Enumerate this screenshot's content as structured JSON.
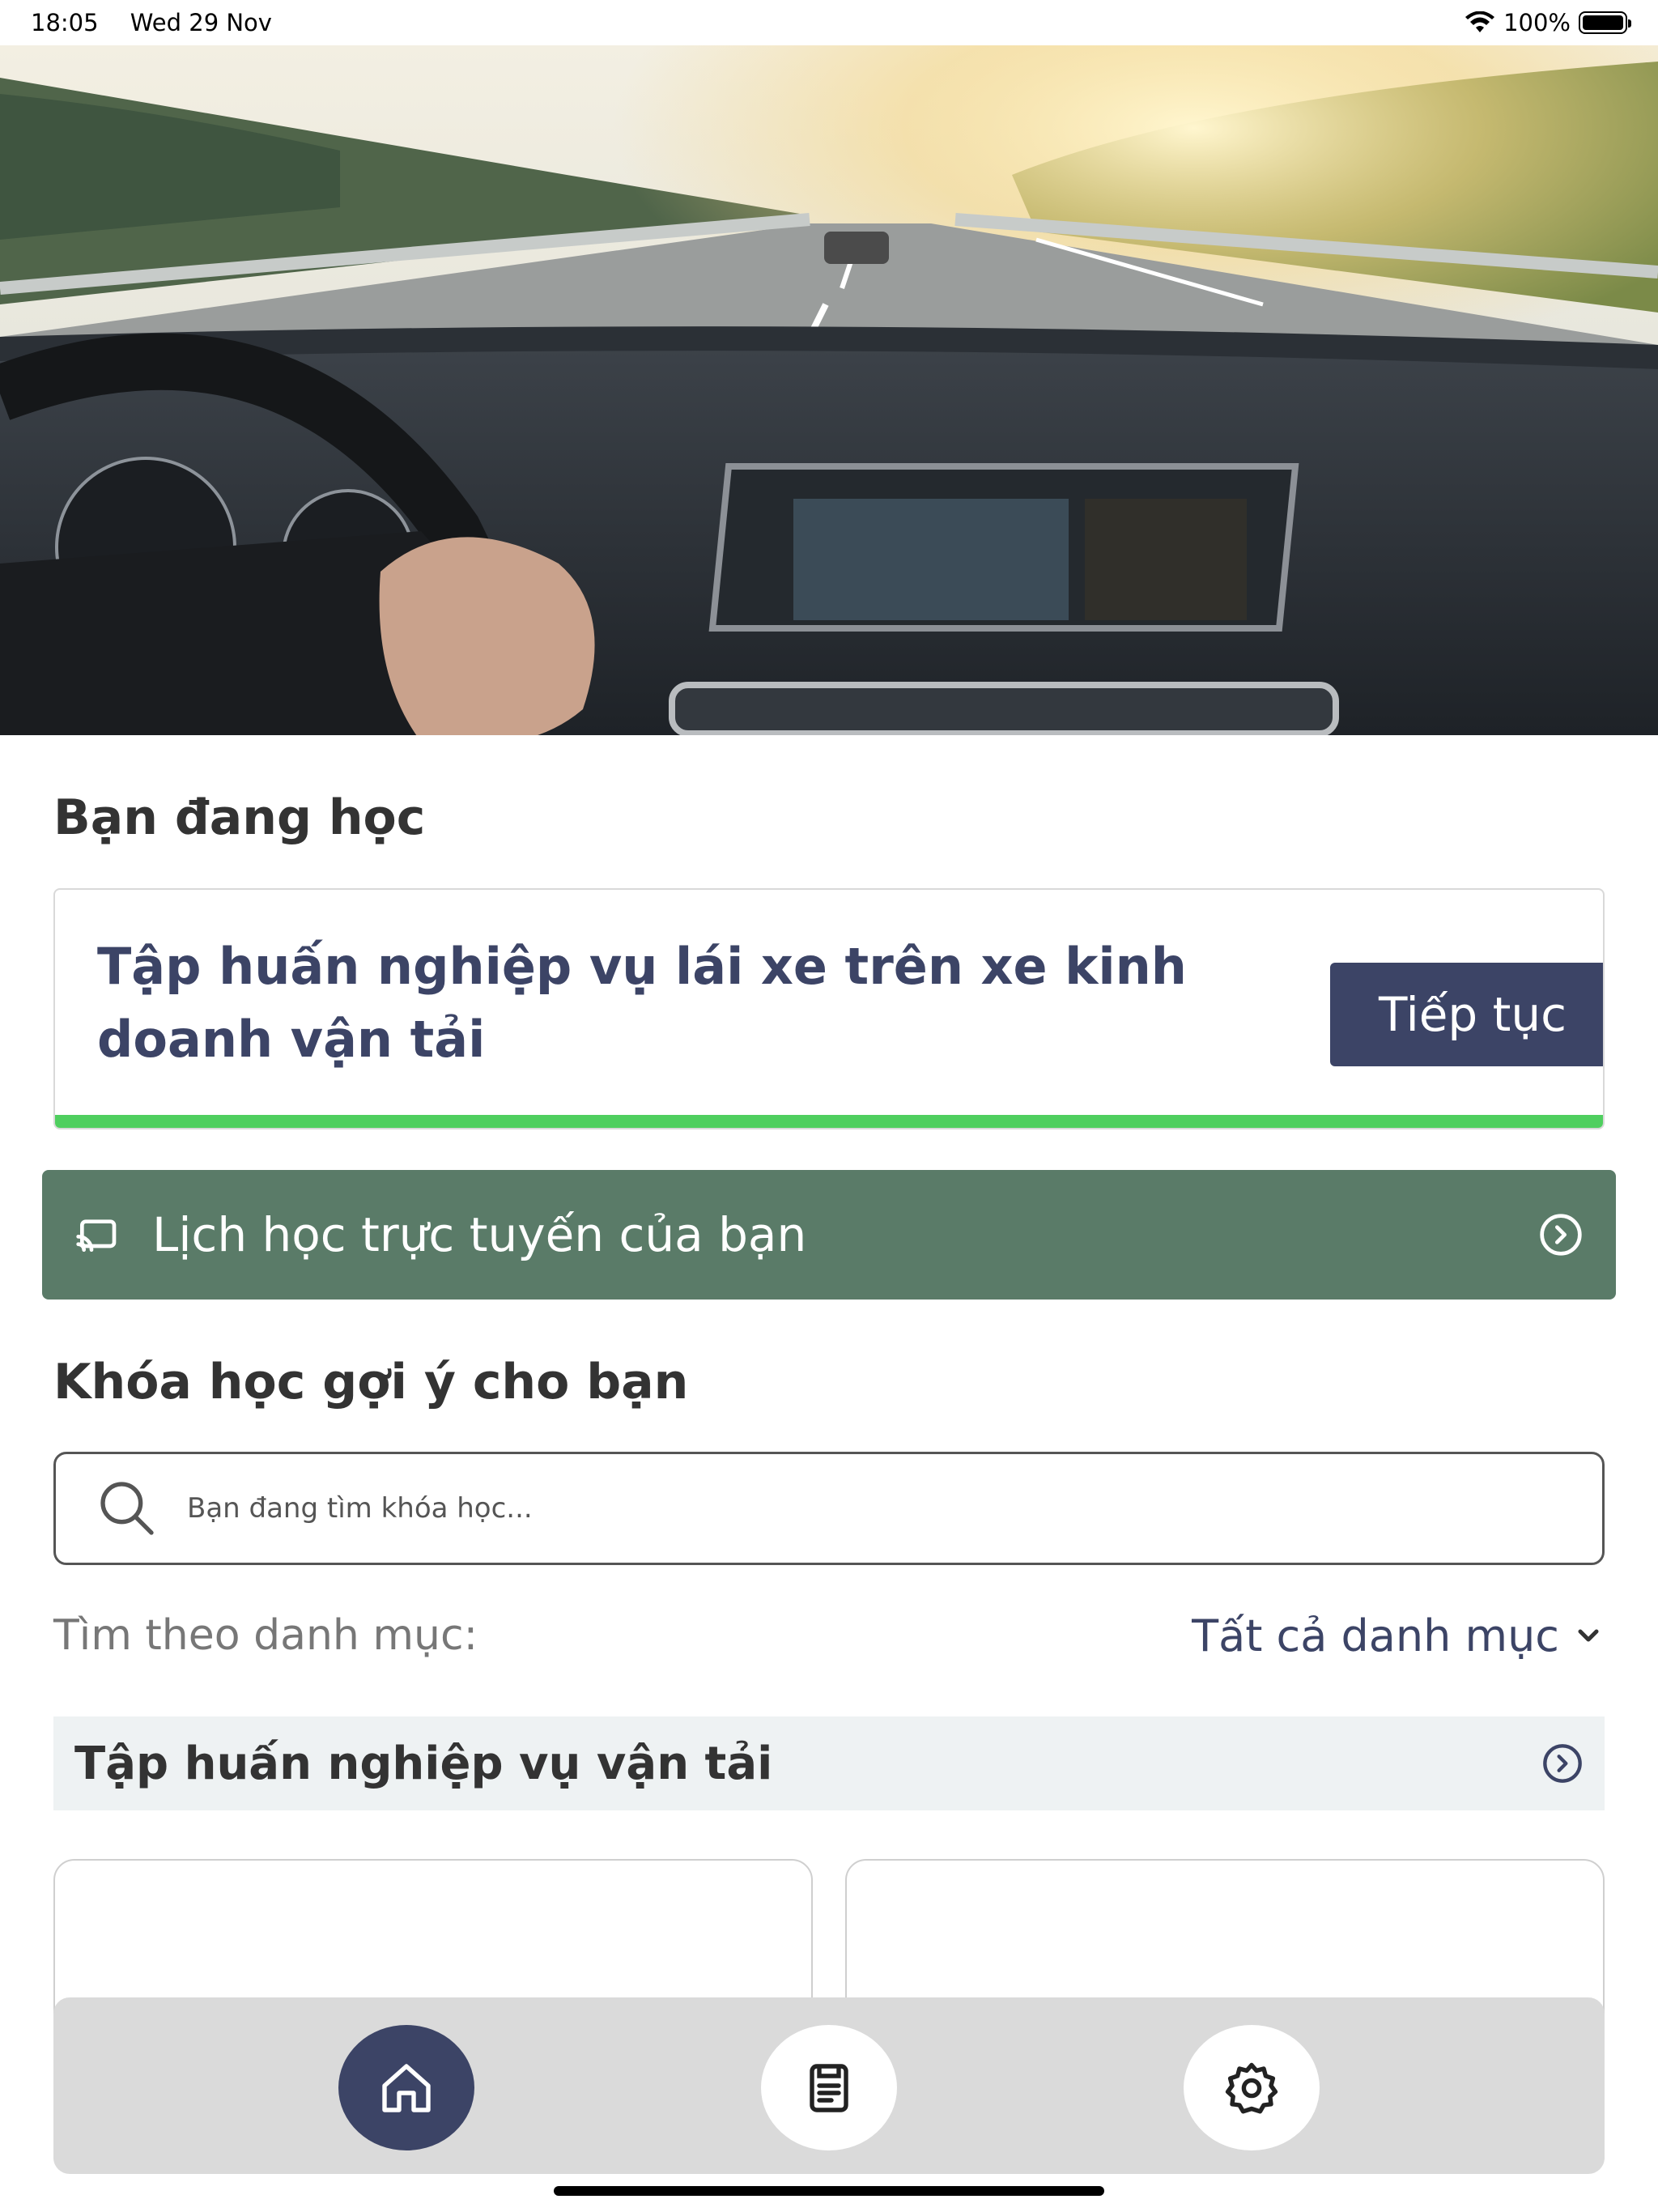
{
  "status_bar": {
    "time": "18:05",
    "date": "Wed 29 Nov",
    "battery": "100%"
  },
  "hero": {
    "image": "car-dashboard-highway-photo"
  },
  "current_section": {
    "title": "Bạn đang học",
    "course_title": "Tập huấn nghiệp vụ lái xe trên xe kinh doanh vận tải",
    "continue_label": "Tiếp tục",
    "progress": 1.0
  },
  "schedule_banner": {
    "label": "Lịch học trực tuyến của bạn",
    "icon": "cast-icon",
    "arrow_icon": "chevron-circle-right-icon",
    "color": "#5a7b68"
  },
  "suggest_section": {
    "title": "Khóa học gợi ý cho bạn",
    "search_placeholder": "Bạn đang tìm khóa học...",
    "filter_label": "Tìm theo danh mục:",
    "filter_value": "Tất cả danh mục"
  },
  "category": {
    "title": "Tập huấn nghiệp vụ vận tải"
  },
  "nav": {
    "items": [
      {
        "name": "home",
        "icon": "home-icon",
        "active": true
      },
      {
        "name": "courses",
        "icon": "document-icon",
        "active": false
      },
      {
        "name": "settings",
        "icon": "gear-icon",
        "active": false
      }
    ]
  },
  "colors": {
    "primary": "#3c4466",
    "progress": "#4fcf5f",
    "banner": "#5a7b68",
    "category_bg": "#eef2f3",
    "nav_bg": "#dadada"
  }
}
